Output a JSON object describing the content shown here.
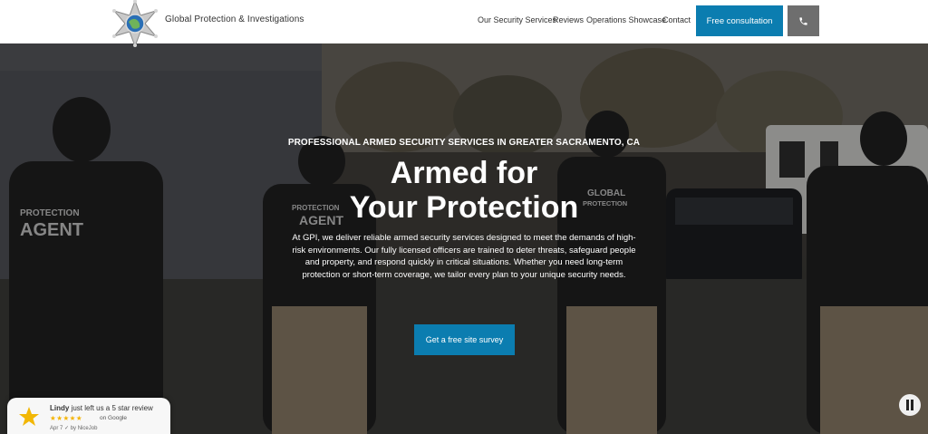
{
  "header": {
    "brand": "Global Protection & Investigations",
    "nav": [
      {
        "label": "Our Security Services"
      },
      {
        "label": "Reviews"
      },
      {
        "label": "Operations Showcase"
      },
      {
        "label": "Contact"
      }
    ],
    "cta_label": "Free consultation",
    "phone_icon": "phone-icon"
  },
  "hero": {
    "eyebrow": "PROFESSIONAL ARMED SECURITY SERVICES IN GREATER SACRAMENTO, CA",
    "title_line1": "Armed for",
    "title_line2": "Your Protection",
    "description": "At GPI, we deliver reliable armed security services designed to meet the demands of high-risk environments. Our fully licensed officers are trained to deter threats, safeguard people and property, and respond quickly in critical situations. Whether you need long-term protection or short-term coverage, we tailor every plan to your unique security needs.",
    "cta_label": "Get a free site survey",
    "image_text": {
      "vest_left": "PROTECTION AGENT",
      "vest_mid": "PROTECTION AGENT",
      "vest_right": "GLOBAL PROTECTION"
    }
  },
  "review_widget": {
    "name": "Lindy",
    "message": " just left us a 5 star review",
    "rating": 5,
    "stars": "★★★★★",
    "platform": "on Google",
    "date": "Apr 7",
    "verified": "by NiceJob"
  },
  "colors": {
    "accent": "#0b7db0",
    "phone_button": "#6e6e6e",
    "star": "#f4b400"
  }
}
